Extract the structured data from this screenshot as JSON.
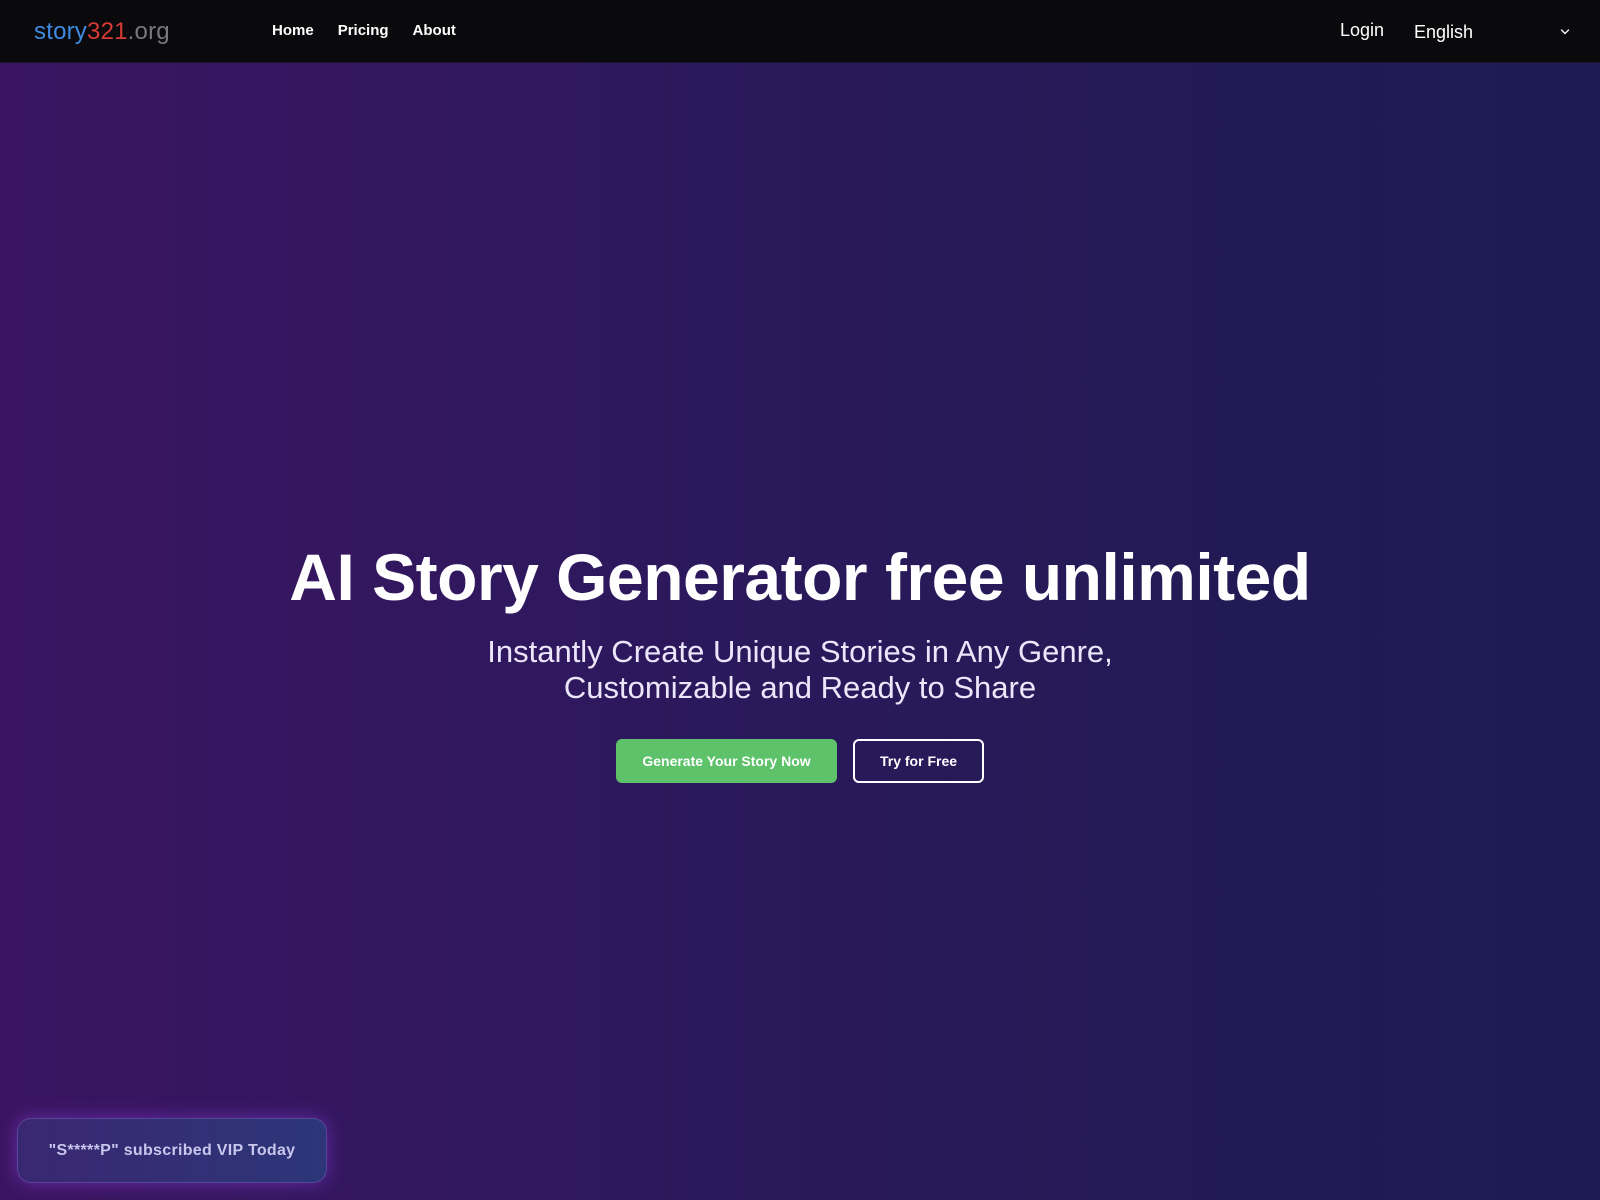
{
  "nav": {
    "logo": {
      "part1": "story",
      "part2": "321",
      "part3": ".org"
    },
    "links": [
      {
        "label": "Home"
      },
      {
        "label": "Pricing"
      },
      {
        "label": "About"
      }
    ],
    "login_label": "Login",
    "language": {
      "selected": "English",
      "icon": "chevron-down-icon"
    }
  },
  "hero": {
    "title": "AI Story Generator free unlimited",
    "subtitle": "Instantly Create Unique Stories in Any Genre, Customizable and Ready to Share",
    "primary_cta": "Generate Your Story Now",
    "secondary_cta": "Try for Free"
  },
  "toast": {
    "message": "\"S*****P\" subscribed VIP Today"
  },
  "colors": {
    "logo_blue": "#3f8ae0",
    "logo_red": "#d63b33",
    "logo_gray": "#77777d",
    "primary_button": "#5ec26a",
    "nav_background": "#0a0a0d",
    "gradient_start": "#3b1561",
    "gradient_end": "#1d1b52"
  }
}
